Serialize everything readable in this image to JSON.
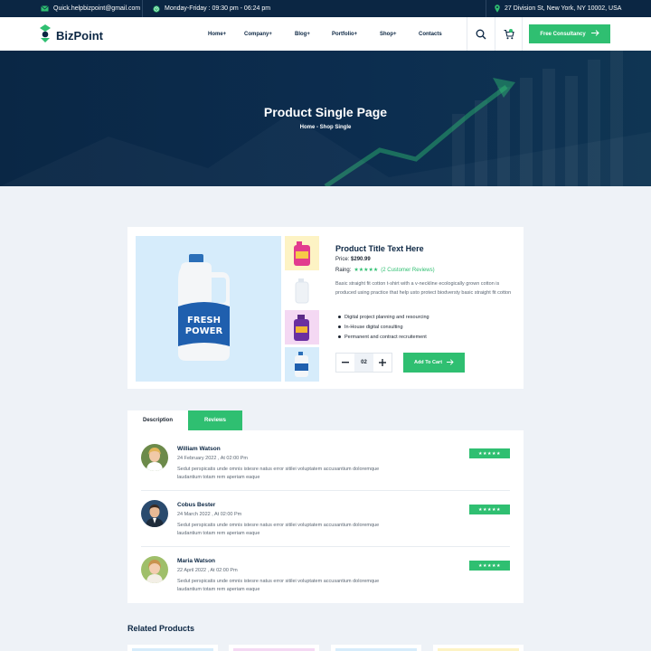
{
  "topbar": {
    "email": "Quick.helpbizpoint@gmail.com",
    "hours": "Monday-Friday : 09:30 pm - 06:24 pm",
    "address": "27 Division St, New York, NY 10002, USA"
  },
  "nav": {
    "logo": "BizPoint",
    "items": [
      "Home+",
      "Company+",
      "Blog+",
      "Portfolio+",
      "Shop+",
      "Contacts"
    ],
    "cta": "Free Consultancy",
    "cart_count": "0"
  },
  "hero": {
    "title": "Product Single Page",
    "breadcrumb": "Home - Shop Single"
  },
  "product": {
    "title": "Product Title Text Here",
    "price_label": "Price:",
    "price": "$290.99",
    "rating_label": "Raing:",
    "stars": "★★★★★",
    "rating_count": "(2 Customer Reviews)",
    "description": "Basic straight fit cotton t-shirt with a v-neckline ecologically grown cotton is produced using practice that help usto protect biodversty basic straight fit cotton",
    "features": [
      "Digital project planning and resourcing",
      "In-House digital consulting",
      "Permanent and contract recruitement"
    ],
    "quantity": "02",
    "add_to_cart": "Add To Cart",
    "bottle_label_top": "FRESH",
    "bottle_label_bottom": "POWER"
  },
  "tabs": {
    "description": "Description",
    "reviews": "Reviews"
  },
  "reviews": [
    {
      "name": "William Watson",
      "date": "24 February 2022 , At 02:00 Pm",
      "text": "Sedut perspicatis unde omnis istesre natus error sitilei voluptatem accusantium doloremque laudantium totam rem aperiam eaque",
      "stars": "★★★★★"
    },
    {
      "name": "Cobus Bester",
      "date": "24 March 2022 , At 02:00 Pm",
      "text": "Sedut perspicatis unde omnis istesre natus error sitilei voluptatem accusantium doloremque laudantium totam rem aperiam eaque",
      "stars": "★★★★★"
    },
    {
      "name": "Maria Watson",
      "date": "22 April 2022 , At 02:00 Pm",
      "text": "Sedut perspicatis unde omnis istesre natus error sitilei voluptatem accusantium doloremque laudantium totam rem aperiam eaque",
      "stars": "★★★★★"
    }
  ],
  "related": {
    "title": "Related Products"
  },
  "colors": {
    "accent": "#2fbf71",
    "navy": "#0b2643",
    "background": "#eef2f7"
  }
}
